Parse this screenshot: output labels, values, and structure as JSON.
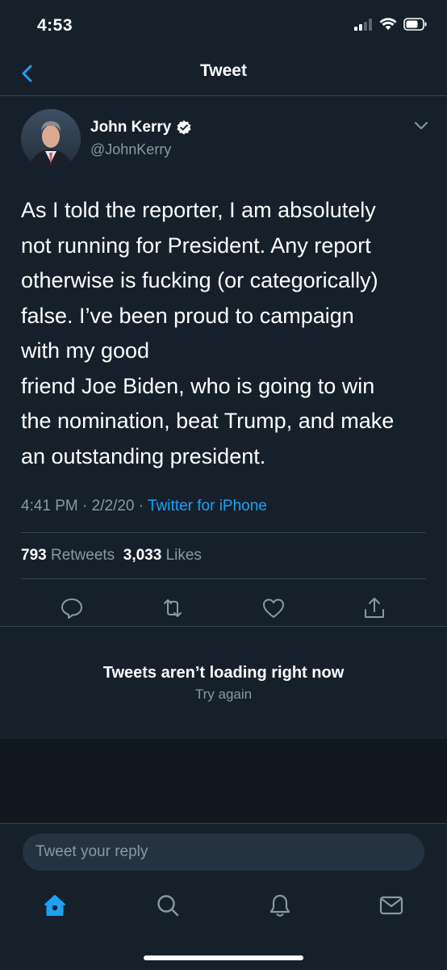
{
  "status_bar": {
    "time": "4:53"
  },
  "header": {
    "title": "Tweet"
  },
  "tweet": {
    "author_name": "John Kerry",
    "author_handle": "@JohnKerry",
    "text_lines": [
      "As I told the reporter, I am absolutely",
      "not running for President. Any report",
      "otherwise is fucking (or categorically)",
      "false. I’ve been proud to campaign",
      "with my good",
      "friend Joe Biden, who is going to win",
      "the nomination, beat Trump, and make",
      "an outstanding president."
    ],
    "time": "4:41 PM",
    "separator": "·",
    "date": "2/2/20",
    "source": "Twitter for iPhone",
    "retweets_count": "793",
    "retweets_label": "Retweets",
    "likes_count": "3,033",
    "likes_label": "Likes"
  },
  "empty_state": {
    "title": "Tweets aren’t loading right now",
    "action": "Try again"
  },
  "reply": {
    "placeholder": "Tweet your reply"
  },
  "colors": {
    "background": "#15202b",
    "accent": "#1da1f2",
    "secondary_text": "#8899a6",
    "divider": "#38444d"
  },
  "icons": {
    "tabs": [
      "home-icon",
      "search-icon",
      "notifications-icon",
      "messages-icon"
    ],
    "actions": [
      "reply-icon",
      "retweet-icon",
      "like-icon",
      "share-icon"
    ]
  }
}
